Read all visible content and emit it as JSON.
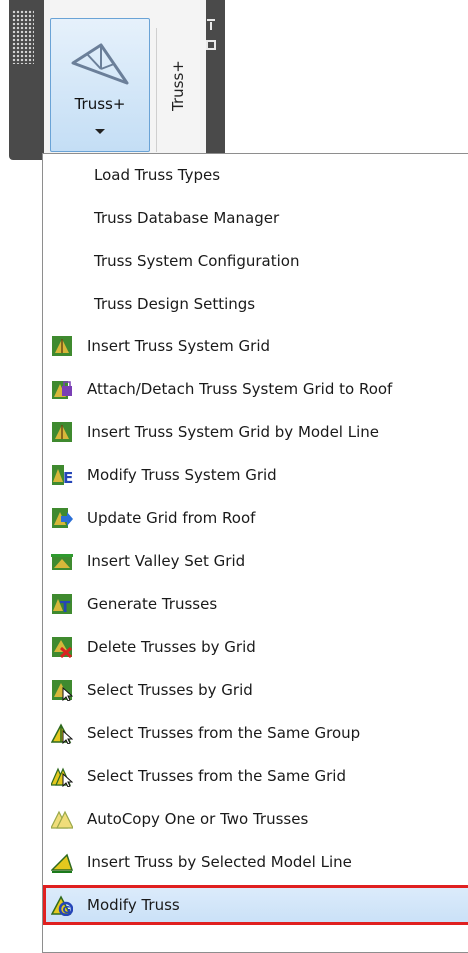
{
  "panel": {
    "button_label": "Truss+",
    "tab_label": "Truss+",
    "button_icon": "truss-icon"
  },
  "menu": {
    "items": [
      {
        "label": "Load Truss Types",
        "icon": ""
      },
      {
        "label": "Truss Database Manager",
        "icon": ""
      },
      {
        "label": "Truss System Configuration",
        "icon": ""
      },
      {
        "label": "Truss Design Settings",
        "icon": ""
      },
      {
        "label": "Insert Truss System Grid",
        "icon": "grid-insert-icon"
      },
      {
        "label": "Attach/Detach Truss System Grid to Roof",
        "icon": "grid-attach-icon"
      },
      {
        "label": "Insert Truss System Grid by Model Line",
        "icon": "grid-model-line-icon"
      },
      {
        "label": "Modify Truss System Grid",
        "icon": "grid-modify-icon"
      },
      {
        "label": "Update Grid from Roof",
        "icon": "grid-update-icon"
      },
      {
        "label": "Insert Valley Set Grid",
        "icon": "valley-grid-icon"
      },
      {
        "label": "Generate Trusses",
        "icon": "generate-icon"
      },
      {
        "label": "Delete Trusses by Grid",
        "icon": "delete-icon"
      },
      {
        "label": "Select Trusses by Grid",
        "icon": "select-grid-icon"
      },
      {
        "label": "Select Trusses from the Same Group",
        "icon": "select-group-icon"
      },
      {
        "label": "Select Trusses from the Same Grid",
        "icon": "select-same-grid-icon"
      },
      {
        "label": "AutoCopy One or Two Trusses",
        "icon": "autocopy-icon"
      },
      {
        "label": "Insert Truss by Selected Model Line",
        "icon": "insert-truss-line-icon"
      },
      {
        "label": "Modify Truss",
        "icon": "modify-truss-icon"
      }
    ]
  },
  "colors": {
    "highlight_border": "#e02020",
    "panel_dark": "#4a4a4a",
    "button_blue": "#c4def5"
  }
}
